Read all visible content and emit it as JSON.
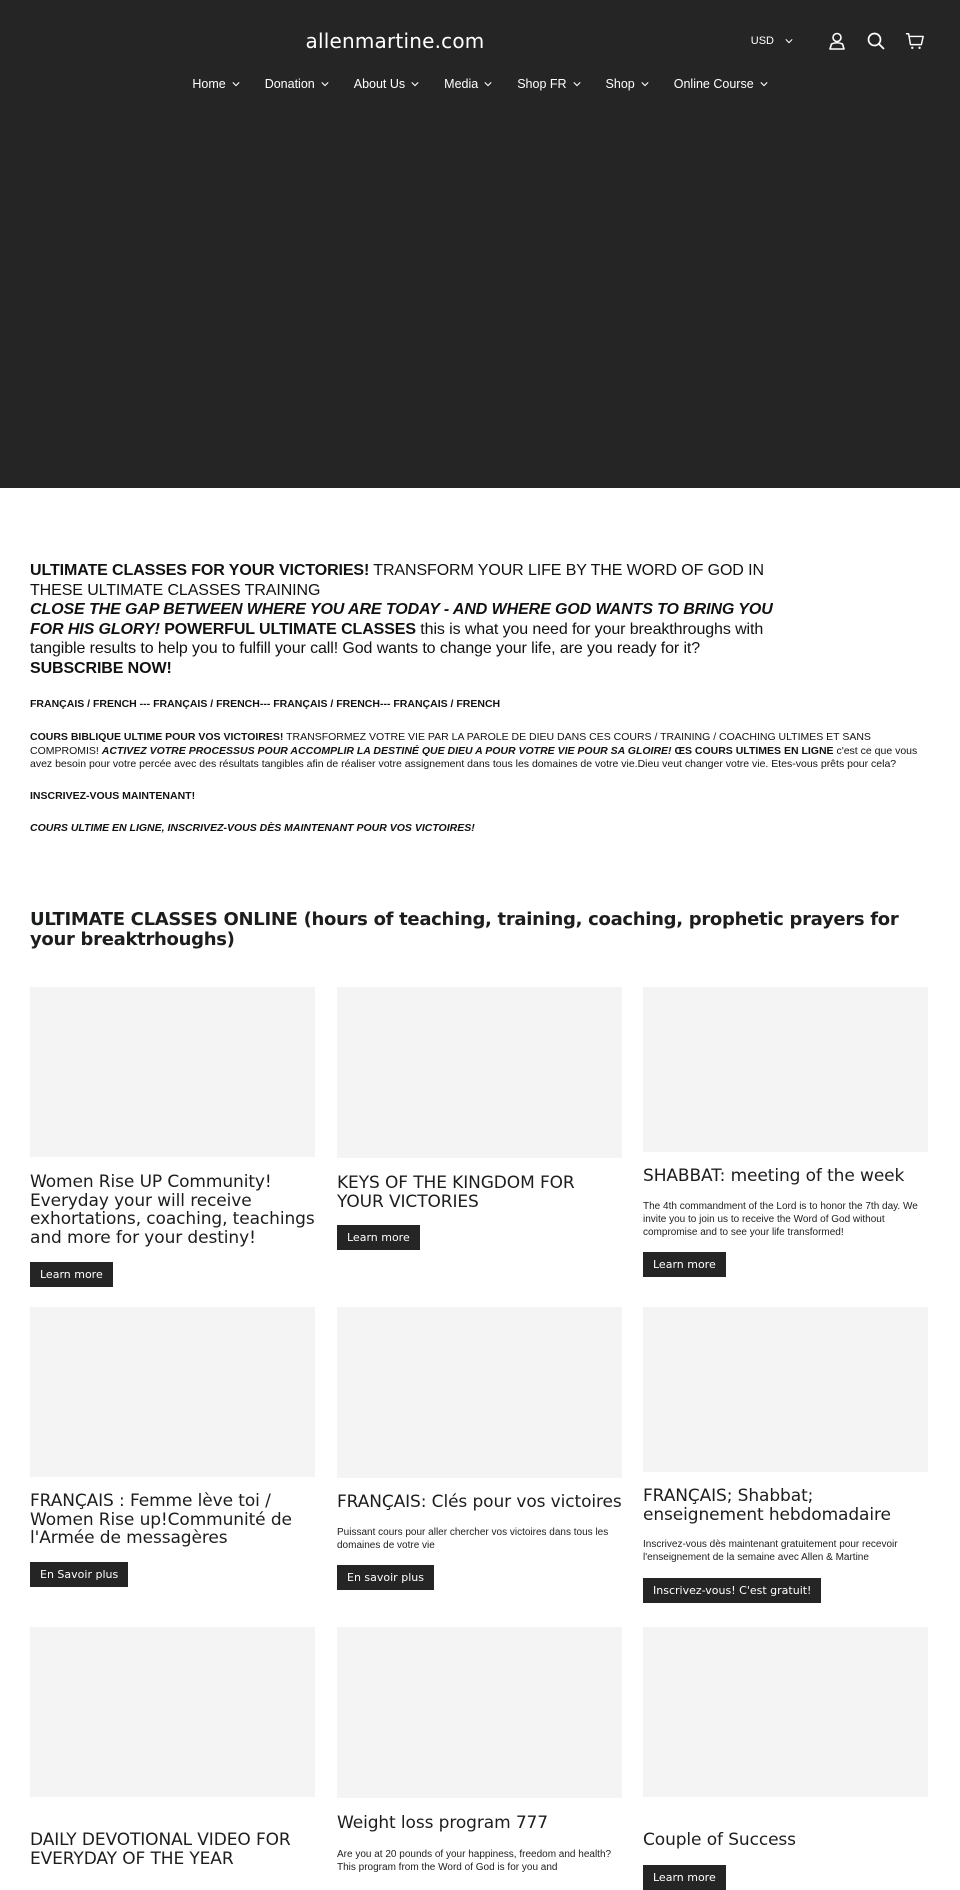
{
  "header": {
    "site_title": "allenmartine.com",
    "currency": "USD",
    "icons": {
      "account": "account-icon",
      "search": "search-icon",
      "cart": "cart-icon"
    },
    "colors": {
      "background": "#252525",
      "text": "#ffffff"
    }
  },
  "nav": {
    "items": [
      {
        "label": "Home"
      },
      {
        "label": "Donation"
      },
      {
        "label": "About Us"
      },
      {
        "label": "Media"
      },
      {
        "label": "Shop FR"
      },
      {
        "label": "Shop"
      },
      {
        "label": "Online Course"
      }
    ]
  },
  "intro": {
    "p1_bold": "ULTIMATE CLASSES FOR YOUR VICTORIES!",
    "p1_rest": " TRANSFORM YOUR LIFE BY THE WORD OF GOD IN THESE ULTIMATE CLASSES TRAINING",
    "p2_bold_italic": "CLOSE THE GAP BETWEEN WHERE YOU ARE TODAY - AND WHERE GOD WANTS TO BRING YOU FOR HIS GLORY!",
    "p2_bold": "  POWERFUL ULTIMATE CLASSES",
    "p2_rest": " this is what you need for your breakthroughs with tangible results to help you to fulfill your call! God wants to change your life, are you ready for it?",
    "p3_bold": "SUBSCRIBE NOW!"
  },
  "french": {
    "header_line": "FRANÇAIS / FRENCH --- FRANÇAIS / FRENCH--- FRANÇAIS / FRENCH--- FRANÇAIS / FRENCH",
    "body_bold": "COURS BIBLIQUE ULTIME POUR VOS VICTOIRES!",
    "body_rest1": " TRANSFORMEZ VOTRE VIE PAR LA PAROLE DE DIEU DANS CES COURS / TRAINING / COACHING ULTIMES ET SANS COMPROMIS! ",
    "body_bold_italic": "ACTIVEZ VOTRE PROCESSUS POUR ACCOMPLIR LA DESTINÉ QUE DIEU A POUR VOTRE VIE POUR SA GLOIRE!",
    "body_bold2": " ŒS COURS ULTIMES EN LIGNE",
    "body_rest2": " c'est ce que vous avez besoin pour votre percée avec des résultats tangibles afin de réaliser votre assignement dans tous les domaines de votre vie.Dieu veut changer votre vie. Etes-vous prêts pour cela?",
    "subscribe": "INSCRIVEZ-VOUS MAINTENANT!",
    "tagline": "COURS ULTIME EN LIGNE, INSCRIVEZ-VOUS DÈS MAINTENANT POUR VOS VICTOIRES!"
  },
  "section": {
    "title": "ULTIMATE CLASSES ONLINE (hours of teaching, training, coaching, prophetic prayers for your breaktrhoughs)"
  },
  "cards": [
    {
      "title": "Women Rise UP Community! Everyday your will receive exhortations, coaching, teachings and more for your destiny!",
      "description": "",
      "button": "Learn more"
    },
    {
      "title": "KEYS OF THE KINGDOM FOR YOUR VICTORIES",
      "description": "",
      "button": "Learn more"
    },
    {
      "title": "SHABBAT: meeting of the week",
      "description": "The 4th commandment of the Lord is to honor the 7th day. We invite you to join us to receive the Word of God without compromise and to see your life transformed!",
      "button": "Learn more"
    },
    {
      "title": "FRANÇAIS : Femme lève toi / Women Rise up!Communité de l'Armée de messagères",
      "description": "",
      "button": "En Savoir plus"
    },
    {
      "title": "FRANÇAIS: Clés pour vos victoires",
      "description": "Puissant cours pour aller chercher vos victoires dans tous les domaines de votre vie",
      "button": "En savoir plus"
    },
    {
      "title": "FRANÇAIS; Shabbat; enseignement hebdomadaire",
      "description": "Inscrivez-vous dès maintenant gratuitement pour recevoir l'enseignement de la semaine avec Allen & Martine",
      "button": "Inscrivez-vous! C'est gratuit!"
    },
    {
      "title": "DAILY DEVOTIONAL VIDEO FOR EVERYDAY OF THE YEAR",
      "description": "",
      "button": ""
    },
    {
      "title": "Weight loss program 777",
      "description": "Are you at 20 pounds of your happiness, freedom and health? This program from the Word of God is for you and",
      "button": ""
    },
    {
      "title": "Couple of Success",
      "description": "",
      "button": "Learn more"
    }
  ]
}
